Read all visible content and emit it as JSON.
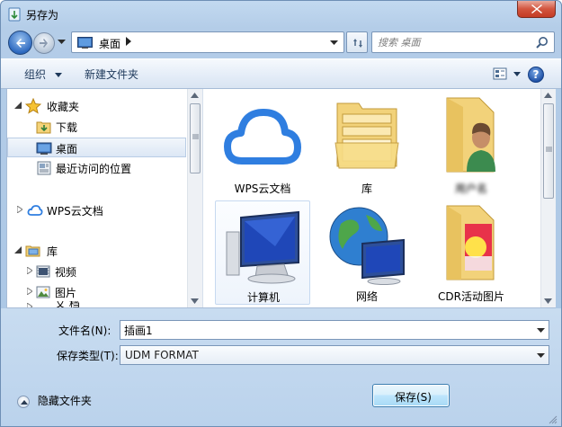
{
  "window": {
    "title": "另存为"
  },
  "address": {
    "path": "桌面"
  },
  "search": {
    "placeholder": "搜索 桌面"
  },
  "toolbar": {
    "organize": "组织",
    "new_folder": "新建文件夹",
    "help": "?"
  },
  "nav": {
    "favorites": "收藏夹",
    "downloads": "下载",
    "desktop": "桌面",
    "recent": "最近访问的位置",
    "wps_cloud": "WPS云文档",
    "libraries": "库",
    "videos": "视频",
    "pictures": "图片",
    "partial": "文 档"
  },
  "files": [
    {
      "label": "WPS云文档",
      "icon": "cloud-icon"
    },
    {
      "label": "库",
      "icon": "library-icon"
    },
    {
      "label": "用户名",
      "icon": "user-folder-icon"
    },
    {
      "label": "计算机",
      "icon": "computer-icon"
    },
    {
      "label": "网络",
      "icon": "network-icon"
    },
    {
      "label": "CDR活动图片",
      "icon": "folder-icon"
    }
  ],
  "form": {
    "filename_label": "文件名(N):",
    "filename_value": "插画1",
    "filetype_label": "保存类型(T):",
    "filetype_value": "UDM FORMAT"
  },
  "footer": {
    "hide_folders": "隐藏文件夹",
    "save": "保存(S)"
  },
  "colors": {
    "accent": "#2f7ee0",
    "selection": "#dce7f5"
  }
}
